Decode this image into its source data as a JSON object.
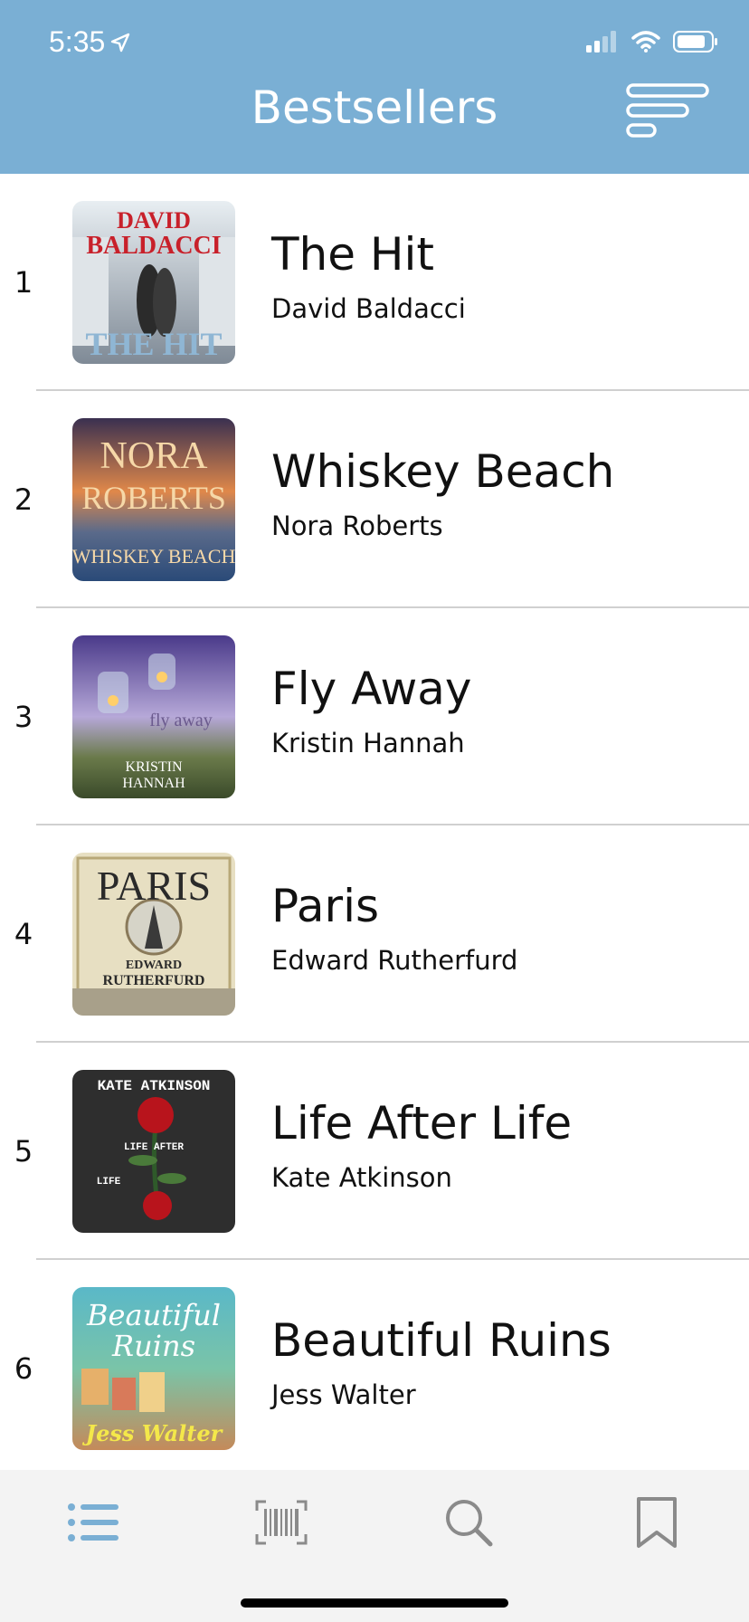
{
  "status": {
    "time": "5:35",
    "location_icon": "location-arrow-icon",
    "signal_icon": "cellular-signal-icon",
    "wifi_icon": "wifi-icon",
    "battery_icon": "battery-icon"
  },
  "header": {
    "title": "Bestsellers",
    "filter_icon": "sort-lines-icon"
  },
  "colors": {
    "header_bg": "#7AAFD4",
    "tab_active": "#7AAFD4",
    "tab_inactive": "#8a8a8a"
  },
  "books": [
    {
      "rank": "1",
      "title": "The Hit",
      "author": "David Baldacci",
      "cover": {
        "top_text": "DAVID",
        "mid_text": "BALDACCI",
        "bottom_text": "THE HIT"
      }
    },
    {
      "rank": "2",
      "title": "Whiskey Beach",
      "author": "Nora Roberts",
      "cover": {
        "top_text": "NORA",
        "mid_text": "ROBERTS",
        "bottom_text": "WHISKEY BEACH"
      }
    },
    {
      "rank": "3",
      "title": "Fly Away",
      "author": "Kristin Hannah",
      "cover": {
        "top_text": "fly away",
        "mid_text": "KRISTIN",
        "bottom_text": "HANNAH"
      }
    },
    {
      "rank": "4",
      "title": "Paris",
      "author": "Edward Rutherfurd",
      "cover": {
        "top_text": "PARIS",
        "mid_text": "EDWARD",
        "bottom_text": "RUTHERFURD"
      }
    },
    {
      "rank": "5",
      "title": "Life After Life",
      "author": "Kate Atkinson",
      "cover": {
        "top_text": "KATE ATKINSON",
        "mid_text": "LIFE AFTER",
        "bottom_text": "LIFE"
      }
    },
    {
      "rank": "6",
      "title": "Beautiful Ruins",
      "author": "Jess Walter",
      "cover": {
        "top_text": "Beautiful",
        "mid_text": "Ruins",
        "bottom_text": "Jess Walter"
      }
    }
  ],
  "tabbar": {
    "tabs": [
      {
        "name": "list",
        "icon": "list-icon",
        "active": true
      },
      {
        "name": "scan",
        "icon": "barcode-icon",
        "active": false
      },
      {
        "name": "search",
        "icon": "search-icon",
        "active": false
      },
      {
        "name": "bookmarks",
        "icon": "bookmark-icon",
        "active": false
      }
    ]
  }
}
